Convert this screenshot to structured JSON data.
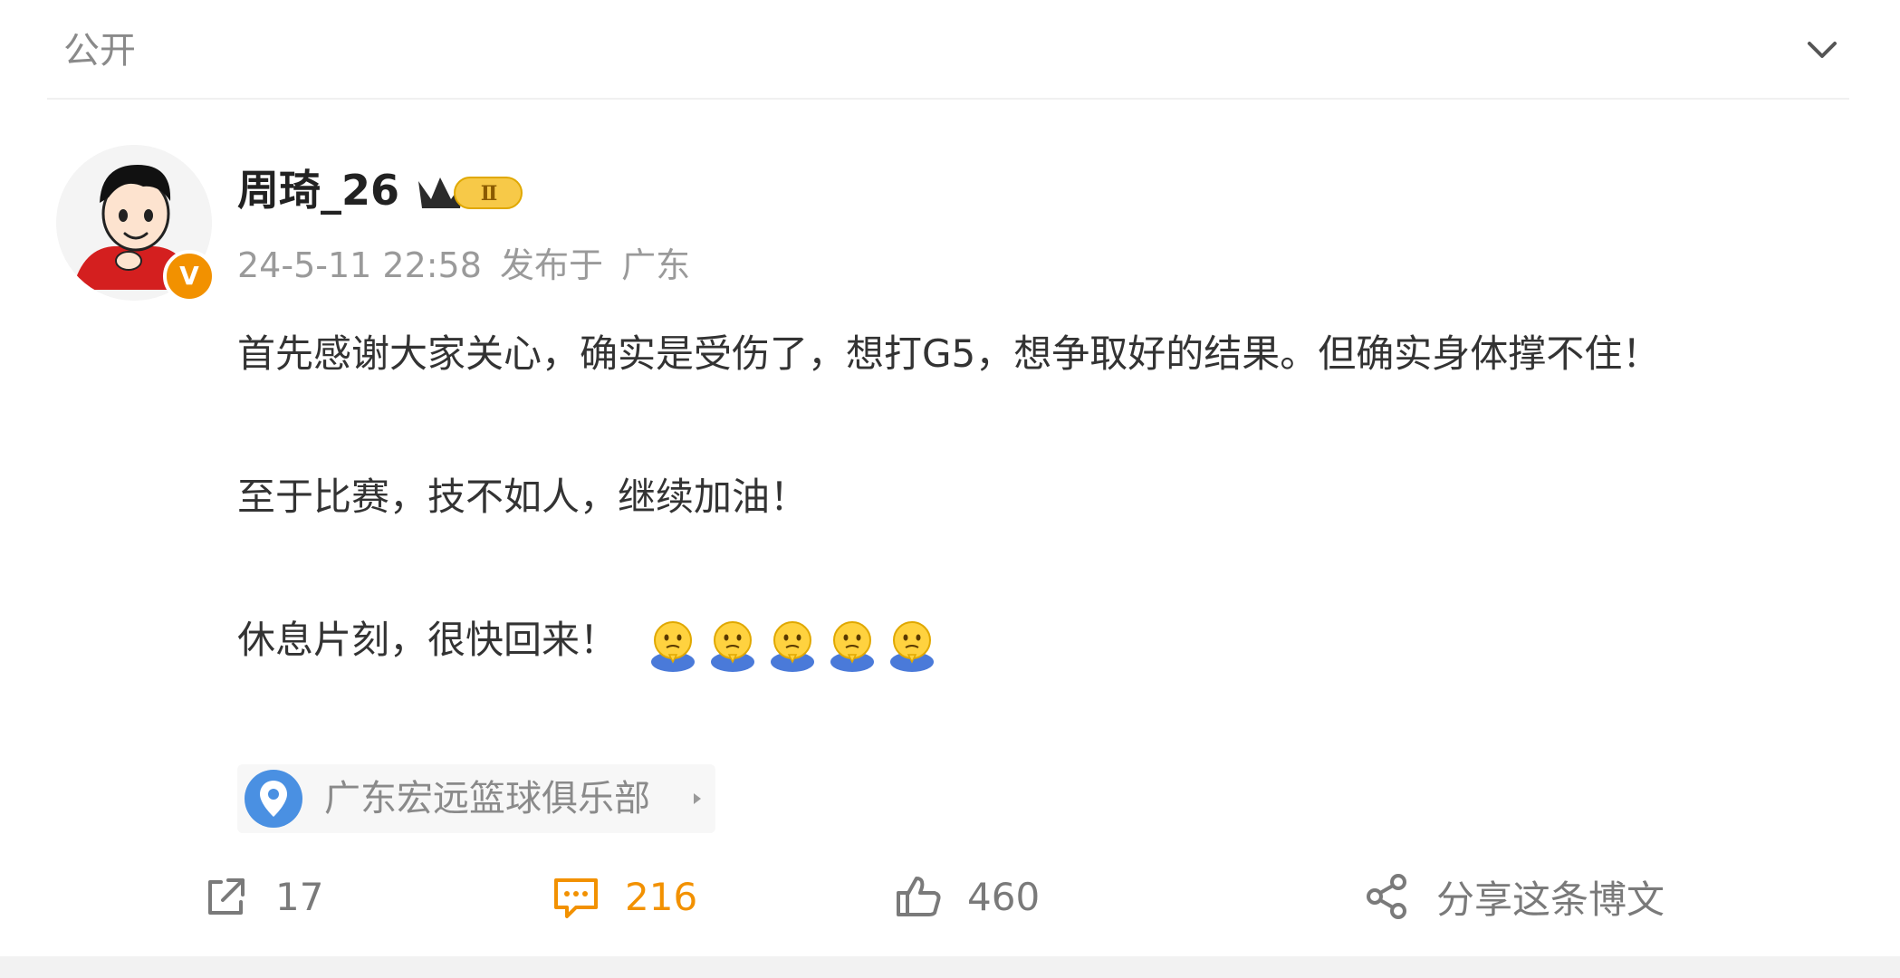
{
  "header": {
    "privacy_label": "公开"
  },
  "post": {
    "author": {
      "name": "周琦_26",
      "verified_badge": "V",
      "crown_level": "Ⅱ"
    },
    "meta": {
      "timestamp": "24-5-11 22:58",
      "source_prefix": "发布于",
      "region": "广东"
    },
    "content": {
      "paragraph_1": "首先感谢大家关心，确实是受伤了，想打G5，想争取好的结果。但确实身体撑不住！",
      "paragraph_2": "至于比赛，技不如人，继续加油！",
      "paragraph_3": "休息片刻，很快回来！",
      "emoji_count": 5,
      "emoji_name": "pray-emoji"
    },
    "location": {
      "label": "广东宏远篮球俱乐部"
    },
    "actions": {
      "forward_count": "17",
      "comment_count": "216",
      "like_count": "460",
      "share_label": "分享这条博文"
    }
  },
  "colors": {
    "accent": "#f29100",
    "location_pin": "#4a90e2",
    "text_primary": "#333333",
    "text_secondary": "#9a9a9a"
  }
}
